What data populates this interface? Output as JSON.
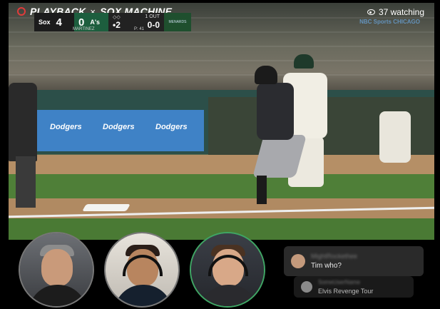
{
  "header": {
    "brand": "PLAYBACK",
    "separator": "×",
    "channel": "SOX MACHINE",
    "watching_count": "37 watching",
    "watching_icon": "eye-icon",
    "network_logo": "NBC Sports CHICAGO"
  },
  "scorebug": {
    "away_abbr": "Sox",
    "away_score": "4",
    "home_abbr": "A's",
    "home_score": "0",
    "outs": "1 OUT",
    "count_balls_strikes": "0-0",
    "pitch_count_label": "•2",
    "pitcher": "MARTINEZ",
    "pitches": "P: 41",
    "sponsor": "MENARDS"
  },
  "video": {
    "banner_texts": [
      "Dodgers",
      "Dodgers",
      "Dodgers"
    ]
  },
  "participants": [
    {
      "name": "participant-1",
      "active": false
    },
    {
      "name": "participant-2",
      "active": false
    },
    {
      "name": "participant-3",
      "active": true
    }
  ],
  "chat": {
    "messages": [
      {
        "user": "MightRockethee",
        "text": "Tim who?",
        "avatar_color": "#c49a7c"
      },
      {
        "user": "SomeUserName",
        "text": "Elvis Revenge Tour",
        "avatar_color": "#8a8a8a"
      }
    ]
  },
  "colors": {
    "accent": "#e03b3b",
    "active_ring": "#3fa564",
    "background": "#000000"
  }
}
